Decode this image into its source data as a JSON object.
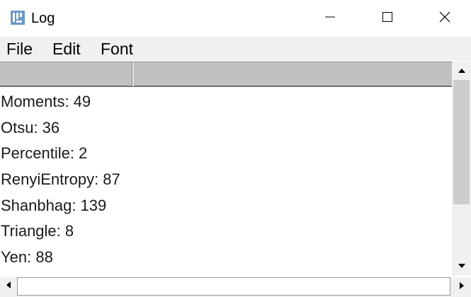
{
  "window": {
    "title": "Log",
    "icon": "imagej-icon",
    "controls": [
      "minimize-icon",
      "maximize-icon",
      "close-icon"
    ]
  },
  "menu": {
    "file": "File",
    "edit": "Edit",
    "font": "Font"
  },
  "log": {
    "lines": [
      "Moments: 49",
      "Otsu: 36",
      "Percentile: 2",
      "RenyiEntropy: 87",
      "Shanbhag: 139",
      "Triangle: 8",
      "Yen: 88"
    ]
  },
  "colors": {
    "menubar": "#f0f0f0",
    "table_header": "#c0c0c0",
    "scroll_thumb": "#cdcdcd"
  }
}
